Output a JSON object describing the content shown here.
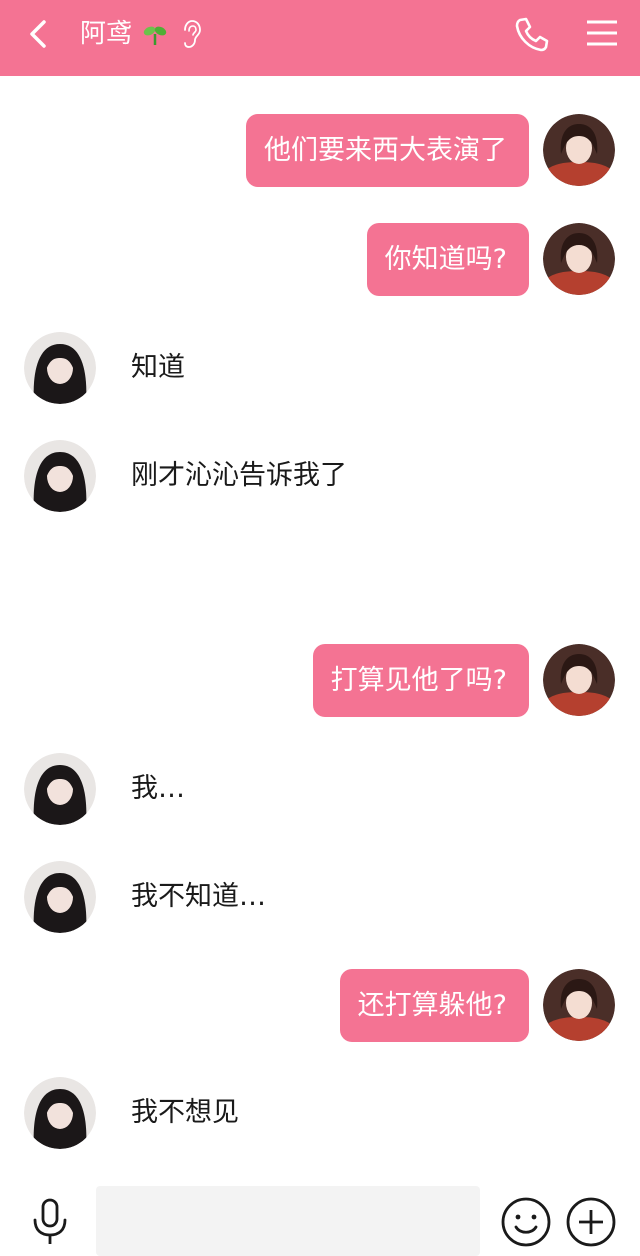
{
  "header": {
    "title": "阿鸢",
    "back_icon": "chevron-left-icon",
    "sprout_icon": "sprout-emoji",
    "ear_icon": "ear-icon",
    "phone_icon": "phone-icon",
    "menu_icon": "menu-icon",
    "background_color": "#f47393"
  },
  "messages": [
    {
      "side": "right",
      "text": "他们要来西大表演了"
    },
    {
      "side": "right",
      "text": "你知道吗?"
    },
    {
      "side": "left",
      "text": "知道"
    },
    {
      "side": "left",
      "text": "刚才沁沁告诉我了"
    },
    {
      "side": "right",
      "text": "打算见他了吗?"
    },
    {
      "side": "left",
      "text": "我…"
    },
    {
      "side": "left",
      "text": "我不知道…"
    },
    {
      "side": "right",
      "text": "还打算躲他?"
    },
    {
      "side": "left",
      "text": "我不想见"
    }
  ],
  "input_bar": {
    "voice_icon": "microphone-icon",
    "input_value": "",
    "emoji_icon": "smiley-icon",
    "more_icon": "plus-circle-icon"
  },
  "colors": {
    "bubble": "#f47393",
    "bubble_text": "#ffffff",
    "plain_text": "#1a1a1a"
  }
}
